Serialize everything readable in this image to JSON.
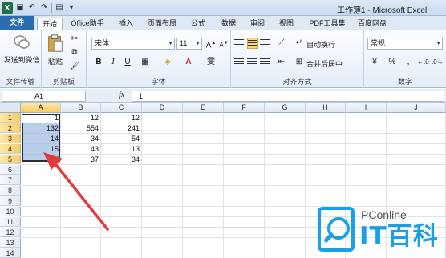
{
  "window": {
    "title": "工作簿1 - Microsoft Excel"
  },
  "tabs": [
    "文件",
    "开始",
    "Office助手",
    "插入",
    "页面布局",
    "公式",
    "数据",
    "审阅",
    "视图",
    "PDF工具集",
    "百度网盘"
  ],
  "ribbon": {
    "wechat": {
      "label": "发送到微信",
      "group": "文件传输"
    },
    "clipboard": {
      "paste_label": "粘贴",
      "group": "剪贴板"
    },
    "font": {
      "name": "宋体",
      "size": "11",
      "group": "字体"
    },
    "alignment": {
      "wrap": "自动换行",
      "merge": "合并后居中",
      "group": "对齐方式"
    },
    "number": {
      "format": "常规",
      "percent": "%",
      "comma": ",",
      "group": "数字"
    }
  },
  "formula_bar": {
    "name_box": "A1",
    "fx": "fx",
    "value": "1"
  },
  "grid": {
    "columns": [
      "A",
      "B",
      "C",
      "D",
      "E",
      "F",
      "G",
      "H",
      "I",
      "J"
    ],
    "rows": [
      "1",
      "2",
      "3",
      "4",
      "5",
      "6",
      "7",
      "8",
      "9",
      "10",
      "11",
      "12",
      "13",
      "14"
    ],
    "cells": {
      "A": [
        "1",
        "132",
        "14",
        "15",
        "7"
      ],
      "B": [
        "12",
        "554",
        "34",
        "43",
        "37"
      ],
      "C": [
        "12",
        "241",
        "54",
        "13",
        "34"
      ]
    }
  },
  "watermark": {
    "brand": "PConline",
    "text": "IT百科",
    "color": "#1aa0e6"
  },
  "annotation": {
    "arrow_color": "#e23b3b"
  }
}
